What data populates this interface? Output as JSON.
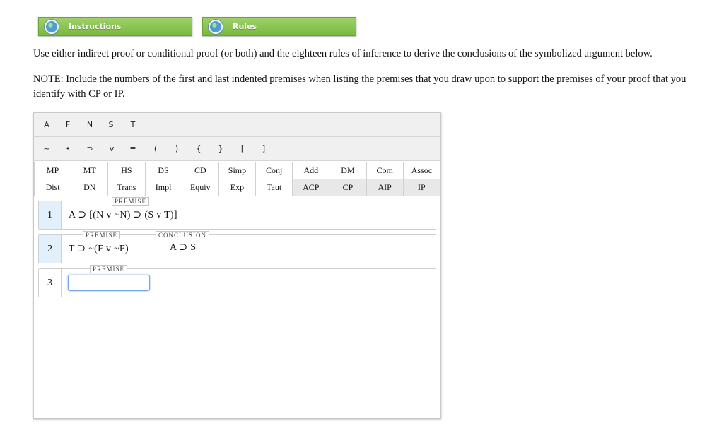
{
  "top_buttons": [
    {
      "label": "Instructions",
      "icon": "globe-icon"
    },
    {
      "label": "Rules",
      "icon": "globe-icon"
    }
  ],
  "text": {
    "instruction": "Use either indirect proof or conditional proof (or both) and the eighteen rules of inference to derive the conclusions of the symbolized argument below.",
    "note": "NOTE: Include the numbers of the first and last indented premises when listing the premises that you draw upon to support the premises of your proof that you identify with CP or IP."
  },
  "letter_keys": [
    "A",
    "F",
    "N",
    "S",
    "T"
  ],
  "symbol_keys": [
    "~",
    "•",
    "⊃",
    "v",
    "≡",
    "(",
    ")",
    "{",
    "}",
    "[",
    "]"
  ],
  "rules_row1": [
    "MP",
    "MT",
    "HS",
    "DS",
    "CD",
    "Simp",
    "Conj",
    "Add",
    "DM",
    "Com",
    "Assoc"
  ],
  "rules_row2": [
    "Dist",
    "DN",
    "Trans",
    "Impl",
    "Equiv",
    "Exp",
    "Taut",
    "ACP",
    "CP",
    "AIP",
    "IP"
  ],
  "proof_lines": [
    {
      "number": "1",
      "tag": "PREMISE",
      "expression": "A ⊃ [(N v ~N) ⊃ (S v T)]"
    },
    {
      "number": "2",
      "tag": "PREMISE",
      "expression": "T ⊃ ~(F v ~F)",
      "conclusion_tag": "CONCLUSION",
      "conclusion": "A ⊃ S"
    },
    {
      "number": "3",
      "tag": "PREMISE",
      "input_value": ""
    }
  ],
  "colors": {
    "button_green": "#79b83e",
    "line_number_bg": "#e2f0fb",
    "input_border": "#7aa7e0"
  }
}
